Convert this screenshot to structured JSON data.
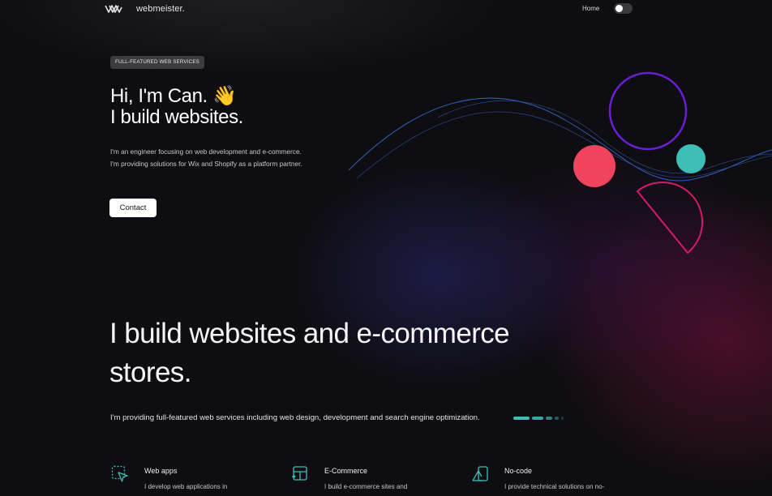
{
  "nav": {
    "logo_text": "webmeister.",
    "home_label": "Home",
    "theme_toggle": {
      "state": "dark"
    }
  },
  "hero": {
    "badge": "FULL-FEATURED WEB SERVICES",
    "title_line1": "Hi, I'm Can. 👋",
    "title_line2": "I build websites.",
    "desc_line1": "I'm an engineer focusing on web development and e-commerce.",
    "desc_line2": "I'm providing solutions for Wix and Shopify as a platform partner.",
    "contact_label": "Contact"
  },
  "section": {
    "title_line1": "I build websites and e-commerce",
    "title_line2": "stores.",
    "lead": "I'm providing full-featured web services including web design, development and search engine optimization."
  },
  "features": [
    {
      "icon": "cursor-pointer-icon",
      "title": "Web apps",
      "desc": "I develop web applications in"
    },
    {
      "icon": "layout-icon",
      "title": "E-Commerce",
      "desc": "I build e-commerce sites and"
    },
    {
      "icon": "shapes-icon",
      "title": "No-code",
      "desc": "I provide technical solutions on no-"
    }
  ],
  "colors": {
    "background": "#0e0d11",
    "accent_teal": "#3dbfb8",
    "accent_purple": "#6a1fd6",
    "accent_red": "#f0435e",
    "accent_pink": "#d6196a",
    "wave_blue": "#2f5fb5"
  }
}
